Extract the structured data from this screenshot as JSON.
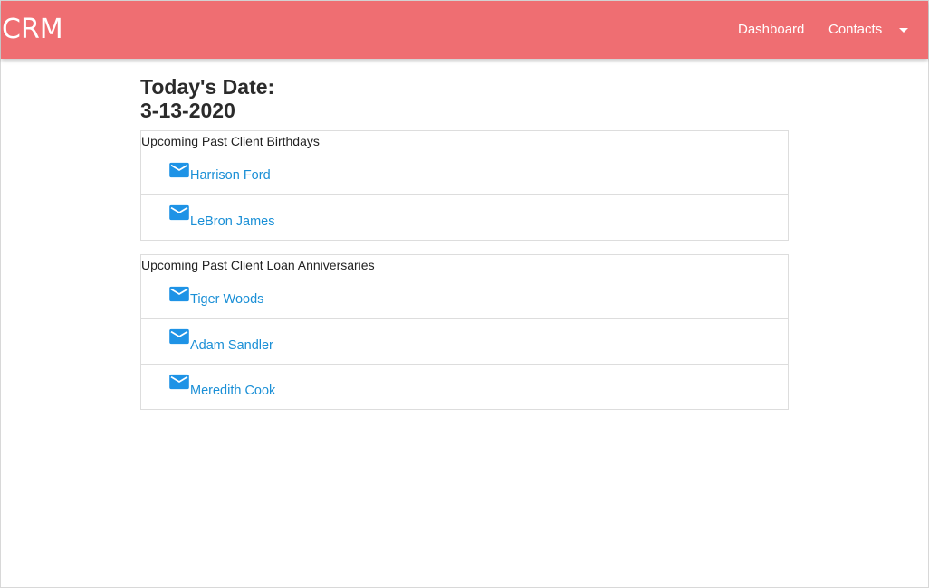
{
  "navbar": {
    "brand": "CRM",
    "links": [
      "Dashboard",
      "Contacts"
    ],
    "color": "#ef6e72"
  },
  "date": {
    "label": "Today's Date:",
    "value": "3-13-2020"
  },
  "birthdays": {
    "title": "Upcoming Past Client Birthdays",
    "clients": [
      "Harrison Ford",
      "LeBron James"
    ]
  },
  "anniversaries": {
    "title": "Upcoming Past Client Loan Anniversaries",
    "clients": [
      "Tiger Woods",
      "Adam Sandler",
      "Meredith Cook"
    ]
  },
  "icons": {
    "mail": "mail-icon",
    "dropdown": "caret-down-icon"
  },
  "colors": {
    "link": "#1a8fd6",
    "icon": "#1e93e6"
  }
}
